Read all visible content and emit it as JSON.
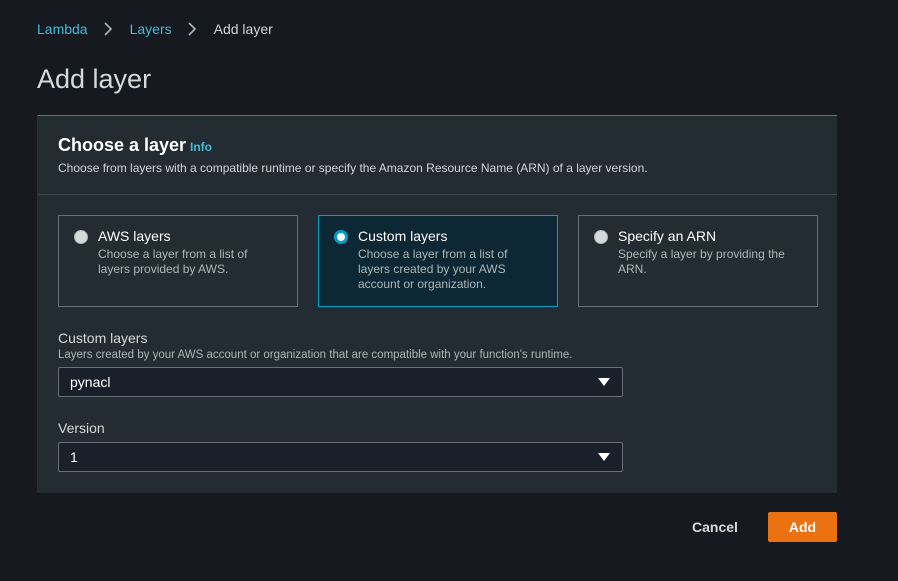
{
  "breadcrumb": {
    "items": [
      "Lambda",
      "Layers"
    ],
    "current": "Add layer"
  },
  "page_title": "Add layer",
  "panel": {
    "title": "Choose a layer",
    "info": "Info",
    "description": "Choose from layers with a compatible runtime or specify the Amazon Resource Name (ARN) of a layer version."
  },
  "layer_source": {
    "selected": "Custom layers",
    "options": [
      {
        "title": "AWS layers",
        "description": "Choose a layer from a list of layers provided by AWS."
      },
      {
        "title": "Custom layers",
        "description": "Choose a layer from a list of layers created by your AWS account or organization."
      },
      {
        "title": "Specify an ARN",
        "description": "Specify a layer by providing the ARN."
      }
    ]
  },
  "custom_layers_field": {
    "label": "Custom layers",
    "description": "Layers created by your AWS account or organization that are compatible with your function's runtime.",
    "value": "pynacl"
  },
  "version_field": {
    "label": "Version",
    "value": "1"
  },
  "actions": {
    "cancel_label": "Cancel",
    "add_label": "Add"
  },
  "colors": {
    "background": "#16191f",
    "panel": "#232b33",
    "link": "#44b9d6",
    "selected_border": "#00a1c9",
    "primary_button": "#ec7211"
  },
  "icons": [
    "chevron-right-icon",
    "caret-down-icon",
    "radio-icon"
  ]
}
